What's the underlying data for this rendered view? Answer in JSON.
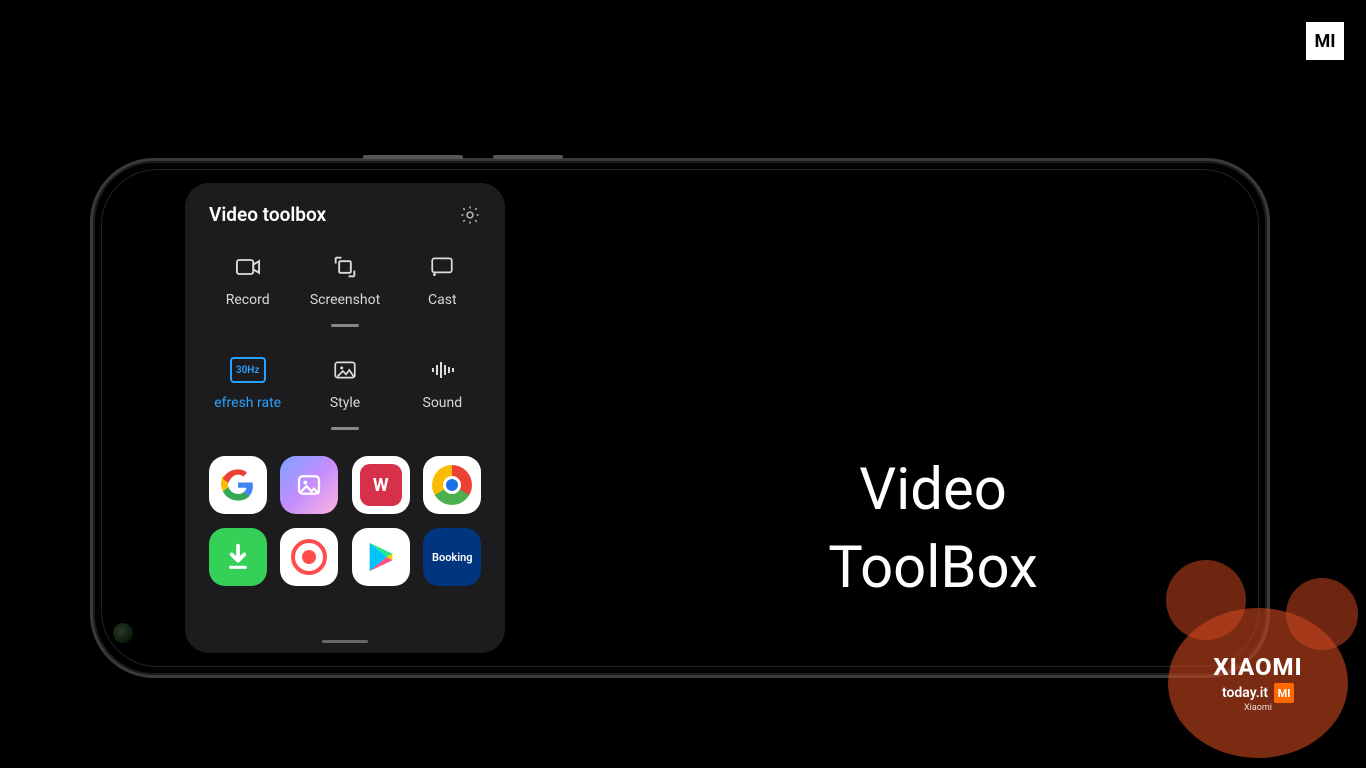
{
  "logo_text": "MI",
  "panel": {
    "title": "Video toolbox",
    "tools": [
      {
        "label": "Record"
      },
      {
        "label": "Screenshot"
      },
      {
        "label": "Cast"
      },
      {
        "label": "efresh rate",
        "badge": "30Hz"
      },
      {
        "label": "Style"
      },
      {
        "label": "Sound"
      }
    ],
    "apps": {
      "google": "G",
      "wps": "W",
      "booking": "Booking"
    }
  },
  "feature": {
    "line1": "Video",
    "line2": "ToolBox"
  },
  "watermark": {
    "brand": "XIAOMI",
    "site": "today.it",
    "mi": "MI",
    "sub": "Xiaomi"
  }
}
